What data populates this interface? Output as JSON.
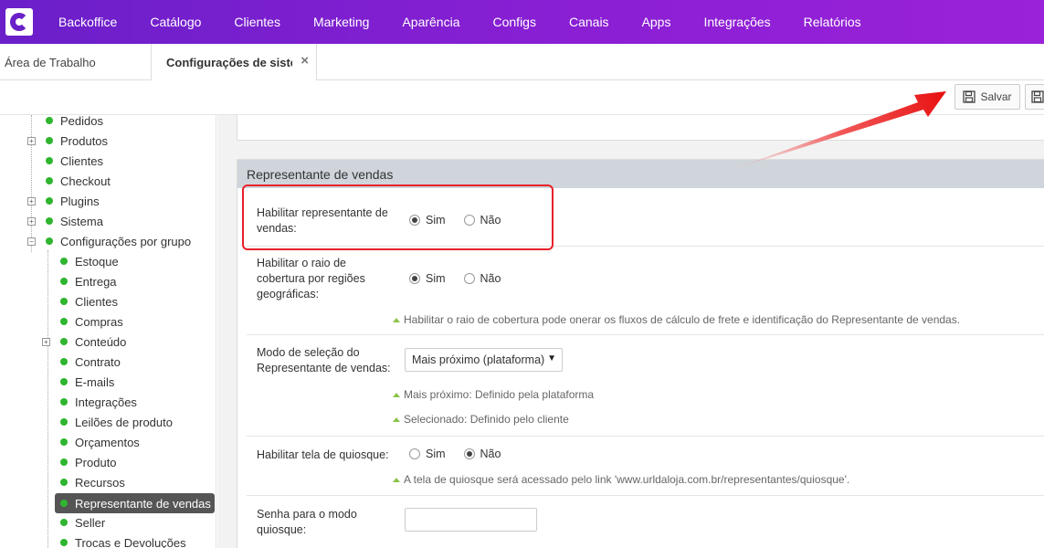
{
  "nav": {
    "items": [
      "Backoffice",
      "Catálogo",
      "Clientes",
      "Marketing",
      "Aparência",
      "Configs",
      "Canais",
      "Apps",
      "Integrações",
      "Relatórios"
    ]
  },
  "tabs": {
    "workspace": "Área de Trabalho",
    "config": "Configurações de sistema",
    "close_icon": "×"
  },
  "toolbar": {
    "save_label": "Salvar"
  },
  "sidebar": {
    "items": [
      "Pedidos",
      "Produtos",
      "Clientes",
      "Checkout",
      "Plugins",
      "Sistema",
      "Configurações por grupo"
    ],
    "group_items": [
      "Estoque",
      "Entrega",
      "Clientes",
      "Compras",
      "Conteúdo",
      "Contrato",
      "E-mails",
      "Integrações",
      "Leilões de produto",
      "Orçamentos",
      "Produto",
      "Recursos",
      "Representante de vendas",
      "Seller",
      "Trocas e Devoluções"
    ]
  },
  "panel": {
    "title": "Representante de vendas",
    "fields": {
      "enable_rep": {
        "label": "Habilitar representante de vendas:",
        "options": [
          "Sim",
          "Não"
        ]
      },
      "enable_radius": {
        "label": "Habilitar o raio de cobertura por regiões geográficas:",
        "options": [
          "Sim",
          "Não"
        ],
        "hint": "Habilitar o raio de cobertura pode onerar os fluxos de cálculo de frete e identificação do Representante de vendas."
      },
      "selection_mode": {
        "label": "Modo de seleção do Representante de vendas:",
        "value": "Mais próximo (plataforma)",
        "hint1": "Mais próximo: Definido pela plataforma",
        "hint2": "Selecionado: Definido pelo cliente"
      },
      "kiosk": {
        "label": "Habilitar tela de quiosque:",
        "options": [
          "Sim",
          "Não"
        ],
        "hint": "A tela de quiosque será acessado pelo link 'www.urldaloja.com.br/representantes/quiosque'."
      },
      "kiosk_password": {
        "label": "Senha para o modo quiosque:",
        "value": ""
      }
    }
  },
  "colors": {
    "nav_start": "#6a1fc9",
    "nav_end": "#9a22d8",
    "status_dot": "#2fb52f",
    "annotation": "#e8202a"
  }
}
